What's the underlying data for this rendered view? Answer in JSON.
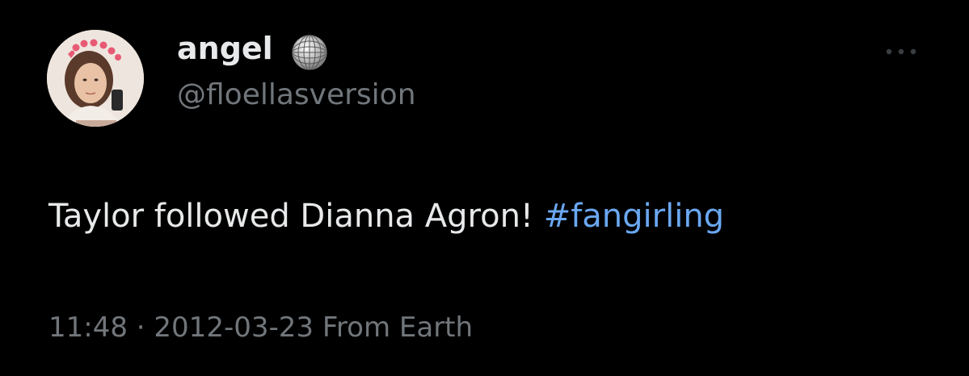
{
  "author": {
    "display_name": "angel",
    "handle": "@floellasversion",
    "badge_icon": "disco-ball-icon",
    "avatar": "profile-photo"
  },
  "tweet": {
    "text": "Taylor followed Dianna Agron!",
    "hashtag": "#fangirling",
    "time": "11:48",
    "separator": "·",
    "date": "2012-03-23",
    "source": "From Earth"
  },
  "actions": {
    "more_icon": "more-horizontal-icon"
  },
  "colors": {
    "background": "#000000",
    "primary_text": "#e7e9ea",
    "secondary_text": "#71767b",
    "link": "#6aa7f1"
  }
}
